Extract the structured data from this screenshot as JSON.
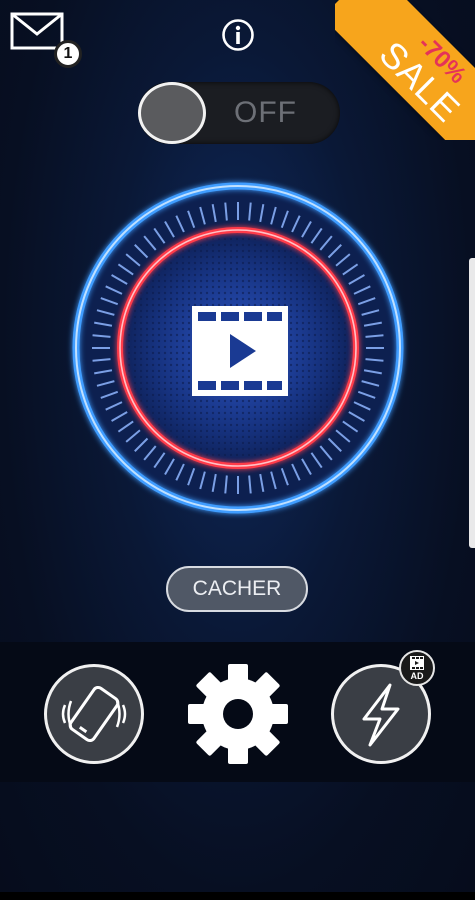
{
  "top": {
    "mail_badge": "1",
    "sale": {
      "percent": "-70%",
      "word": "SALE"
    }
  },
  "toggle": {
    "state": "OFF"
  },
  "actions": {
    "hide_label": "CACHER",
    "ad_label": "AD"
  },
  "icons": {
    "mail": "mail-icon",
    "info": "info-icon",
    "film": "video-film-icon",
    "vibrate": "phone-vibrate-icon",
    "settings": "gear-icon",
    "flash": "lightning-icon"
  },
  "colors": {
    "outer_ring": "#3f9dff",
    "inner_ring": "#ff3b4a",
    "sale_ribbon": "#f7a51c",
    "sale_percent": "#e53358"
  }
}
